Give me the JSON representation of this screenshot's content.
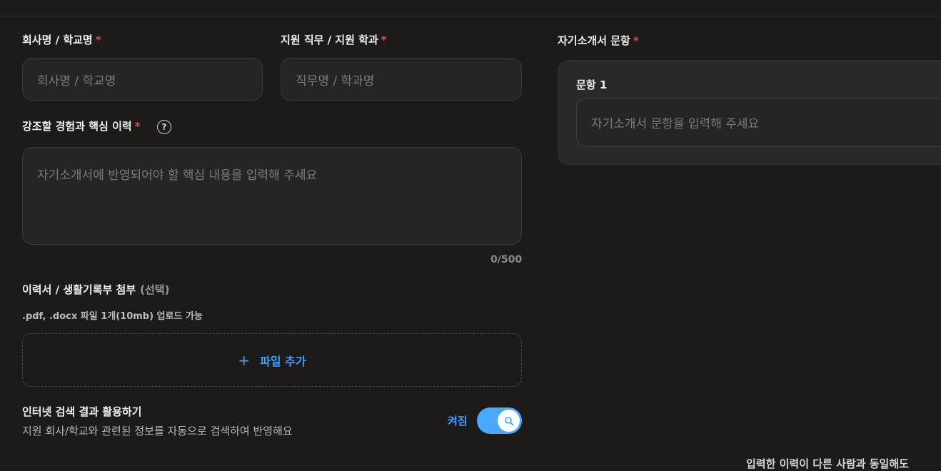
{
  "form": {
    "company": {
      "label": "회사명 / 학교명",
      "required_mark": "*",
      "placeholder": "회사명 / 학교명"
    },
    "position": {
      "label": "지원 직무 / 지원 학과",
      "required_mark": "*",
      "placeholder": "직무명 / 학과명"
    },
    "experience": {
      "label": "강조할 경험과 핵심 이력",
      "required_mark": "*",
      "help_icon": "?",
      "placeholder": "자기소개서에 반영되어야 할 핵심 내용을 입력해 주세요",
      "counter": "0/500"
    },
    "attachment": {
      "label": "이력서 / 생활기록부 첨부",
      "optional": "(선택)",
      "hint": ".pdf, .docx 파일 1개(10mb) 업로드 가능",
      "plus": "+",
      "button": "파일 추가"
    },
    "internet_search": {
      "title": "인터넷 검색 결과 활용하기",
      "description": "지원 회사/학교와 관련된 정보를 자동으로 검색하여 반영해요",
      "state_label": "켜짐",
      "enabled": true
    }
  },
  "questions": {
    "label": "자기소개서 문항",
    "required_mark": "*",
    "items": [
      {
        "label": "문항 1",
        "placeholder": "자기소개서 문항을 입력해 주세요"
      }
    ],
    "bottom_note": "입력한 이력이 다른 사람과 동일해도"
  },
  "colors": {
    "background": "#1c1b1a",
    "accent": "#4aa8ff",
    "required": "#e5484d"
  }
}
